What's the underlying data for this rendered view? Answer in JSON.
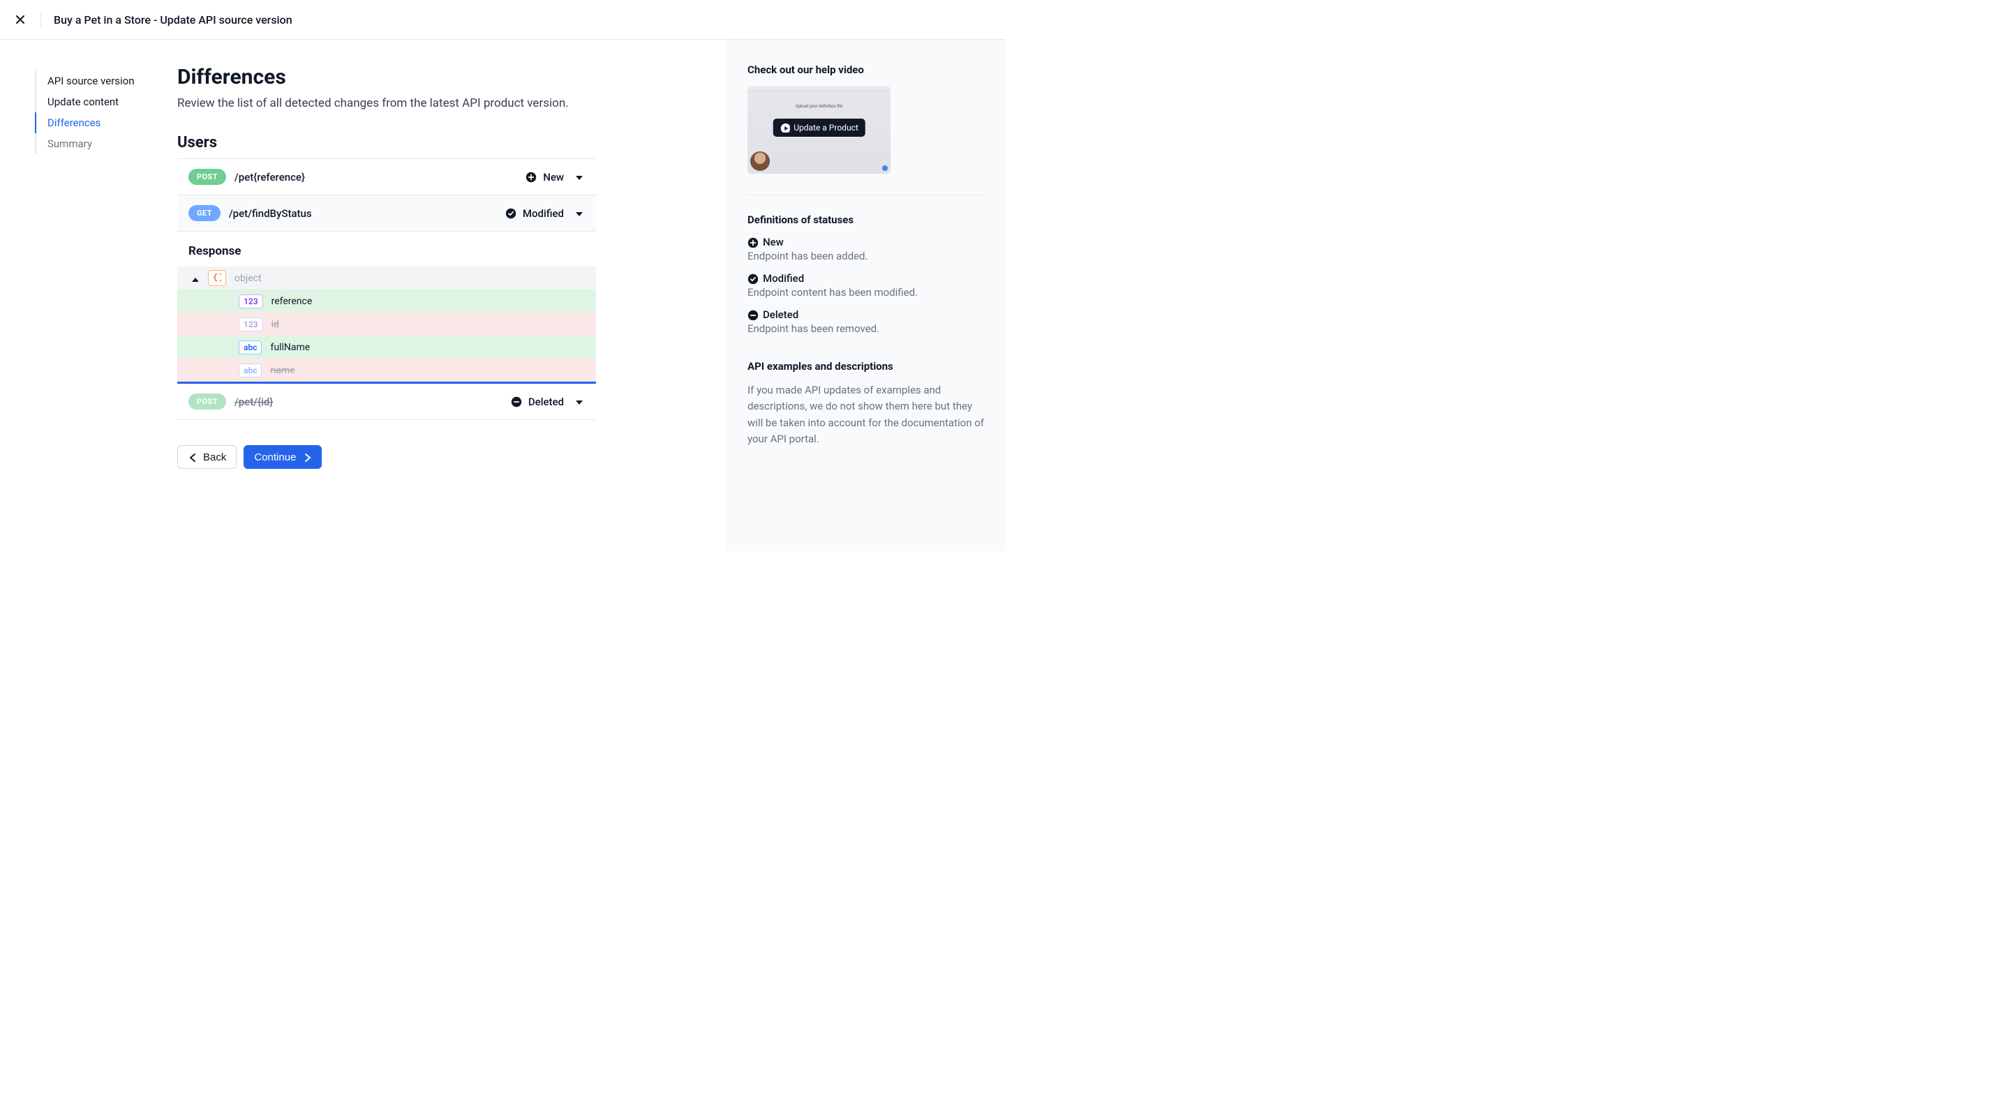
{
  "header": {
    "title": "Buy a Pet in a Store - Update API source version"
  },
  "nav": {
    "items": [
      {
        "label": "API source version",
        "state": "done"
      },
      {
        "label": "Update content",
        "state": "done"
      },
      {
        "label": "Differences",
        "state": "active"
      },
      {
        "label": "Summary",
        "state": "muted"
      }
    ]
  },
  "page": {
    "title": "Differences",
    "subtitle": "Review the list of all detected changes from the latest API product version."
  },
  "section": {
    "title": "Users"
  },
  "endpoints": [
    {
      "method": "POST",
      "method_style": "post",
      "path": "/pet{reference}",
      "status_icon": "plus-circle",
      "status": "New",
      "faded": false,
      "strike": false
    },
    {
      "method": "GET",
      "method_style": "get",
      "path": "/pet/findByStatus",
      "status_icon": "check-circle",
      "status": "Modified",
      "faded": false,
      "strike": false
    },
    {
      "method": "POST",
      "method_style": "post",
      "path": "/pet/{id}",
      "status_icon": "minus-circle",
      "status": "Deleted",
      "faded": true,
      "strike": true
    }
  ],
  "response": {
    "title": "Response",
    "root_label": "object",
    "fields": [
      {
        "pill": "123",
        "pill_style": "num",
        "name": "reference",
        "change": "added"
      },
      {
        "pill": "123",
        "pill_style": "num-faded",
        "name": "id",
        "change": "removed"
      },
      {
        "pill": "abc",
        "pill_style": "str",
        "name": "fullName",
        "change": "added"
      },
      {
        "pill": "abc",
        "pill_style": "str-faded",
        "name": "name",
        "change": "removed"
      }
    ]
  },
  "actions": {
    "back": "Back",
    "continue": "Continue"
  },
  "right": {
    "video_heading": "Check out our help video",
    "video_button": "Update a Product",
    "video_topline": "Upload your definition file",
    "defs_heading": "Definitions of statuses",
    "defs": [
      {
        "icon": "plus-circle",
        "title": "New",
        "desc": "Endpoint has been added."
      },
      {
        "icon": "check-circle",
        "title": "Modified",
        "desc": "Endpoint content has been modified."
      },
      {
        "icon": "minus-circle",
        "title": "Deleted",
        "desc": "Endpoint has been removed."
      }
    ],
    "examples_heading": "API examples and descriptions",
    "examples_body": "If you made API updates of examples and descriptions, we do not show them here but they will be taken into account for the documentation of your API portal."
  }
}
